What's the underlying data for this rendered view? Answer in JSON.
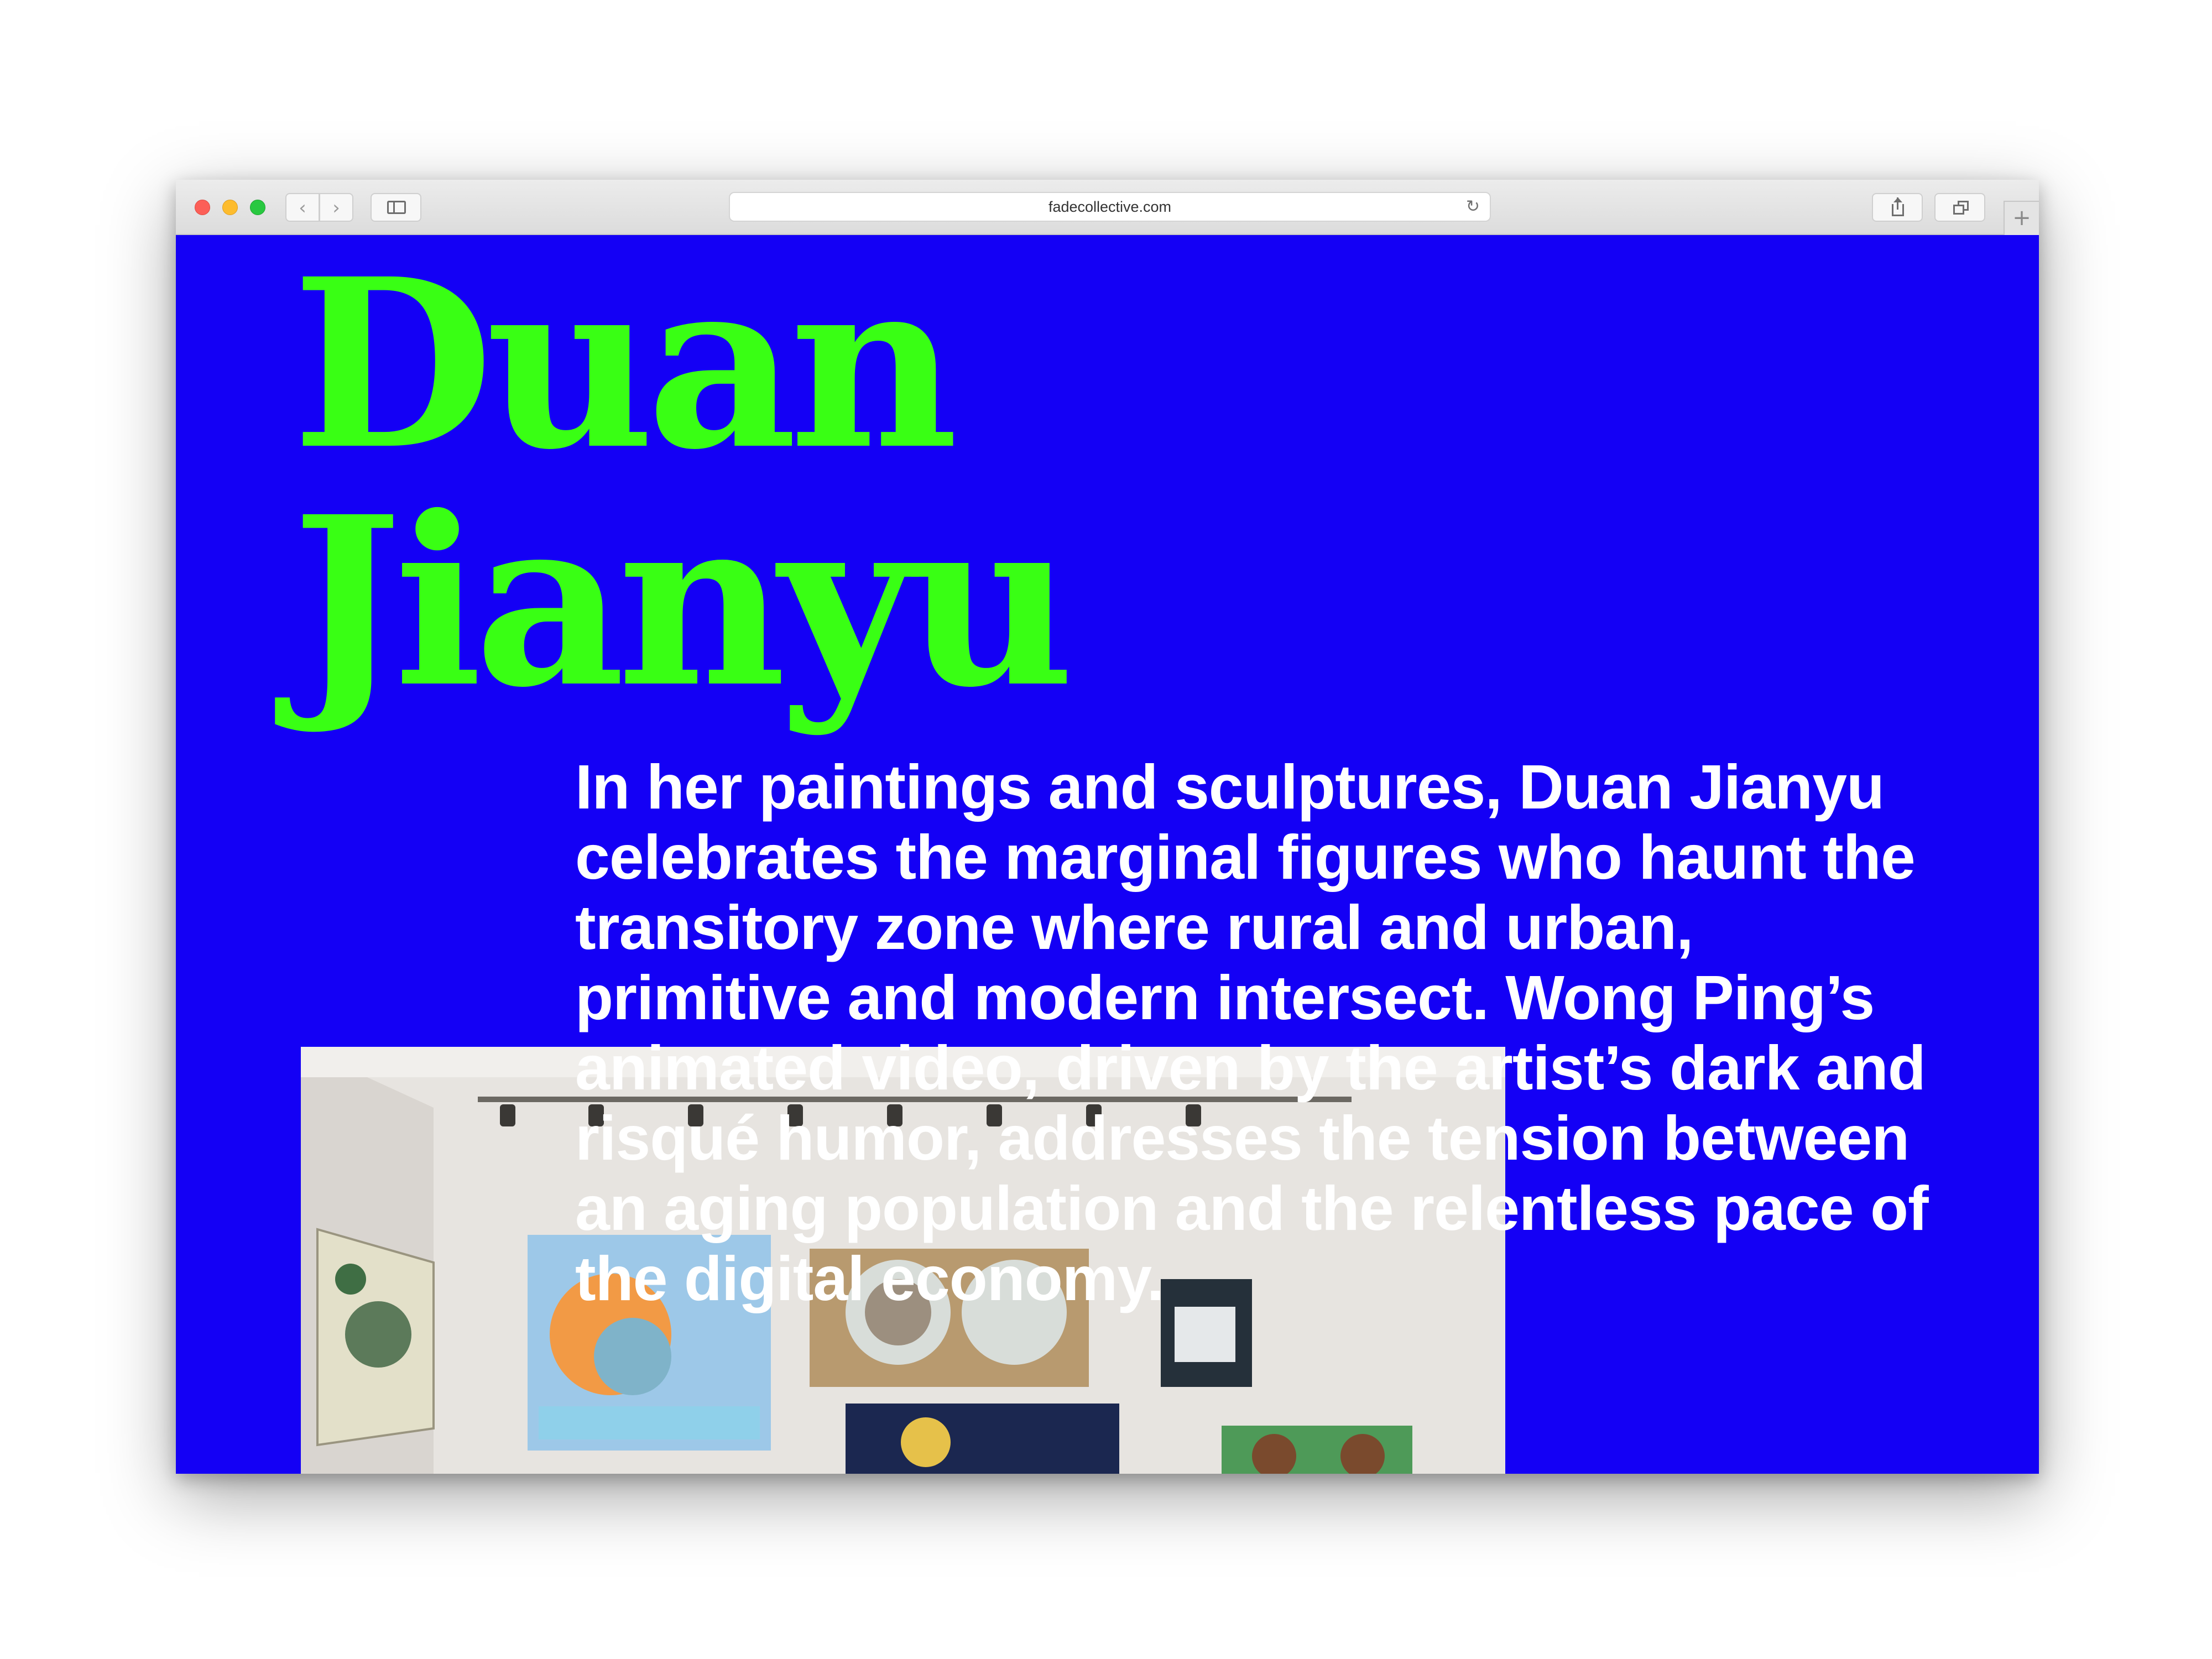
{
  "browser": {
    "url": "fadecollective.com",
    "back_icon": "chevron-left-icon",
    "forward_icon": "chevron-right-icon",
    "sidebar_icon": "sidebar-icon",
    "reload_icon": "reload-icon",
    "share_icon": "share-icon",
    "tabs_icon": "tabs-overview-icon",
    "new_tab_icon": "plus-icon"
  },
  "page": {
    "artist_name": "Duan\nJianyu",
    "bio": "In her paintings and sculptures, Duan Jianyu celebrates the marginal figures who haunt the transitory zone where rural and urban, primitive and modern intersect. Wong Ping’s animated video, driven by the artist’s dark and risqué humor, addresses the tension between an aging population and the relentless pace of the digital economy."
  },
  "colors": {
    "background": "#1400f5",
    "title": "#39ff14",
    "body_text": "#ffffff"
  }
}
